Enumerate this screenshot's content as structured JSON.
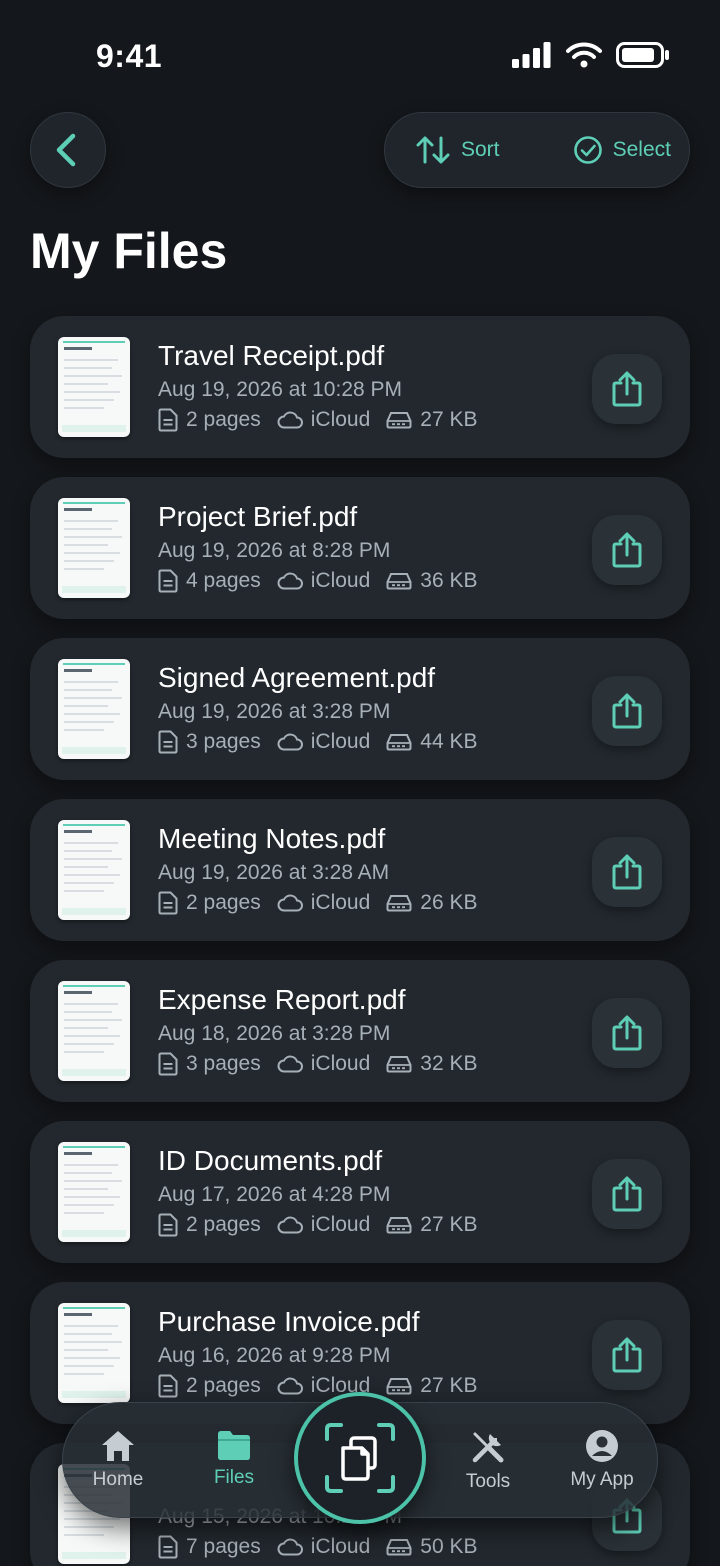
{
  "status_bar": {
    "time": "9:41"
  },
  "toolbar": {
    "sort_label": "Sort",
    "select_label": "Select"
  },
  "title": "My Files",
  "files": [
    {
      "name": "Travel Receipt.pdf",
      "date": "Aug 19, 2026 at 10:28 PM",
      "pages": "2 pages",
      "storage": "iCloud",
      "size": "27 KB",
      "thumb_title": "Travel Receipt"
    },
    {
      "name": "Project Brief.pdf",
      "date": "Aug 19, 2026 at 8:28 PM",
      "pages": "4 pages",
      "storage": "iCloud",
      "size": "36 KB",
      "thumb_title": "Project Brief"
    },
    {
      "name": "Signed Agreement.pdf",
      "date": "Aug 19, 2026 at 3:28 PM",
      "pages": "3 pages",
      "storage": "iCloud",
      "size": "44 KB",
      "thumb_title": "SIGNED AGREEMENT"
    },
    {
      "name": "Meeting Notes.pdf",
      "date": "Aug 19, 2026 at 3:28 AM",
      "pages": "2 pages",
      "storage": "iCloud",
      "size": "26 KB",
      "thumb_title": "Meeting Notes"
    },
    {
      "name": "Expense Report.pdf",
      "date": "Aug 18, 2026 at 3:28 PM",
      "pages": "3 pages",
      "storage": "iCloud",
      "size": "32 KB",
      "thumb_title": "Expense Report"
    },
    {
      "name": "ID Documents.pdf",
      "date": "Aug 17, 2026 at 4:28 PM",
      "pages": "2 pages",
      "storage": "iCloud",
      "size": "27 KB",
      "thumb_title": "ID Documents"
    },
    {
      "name": "Purchase Invoice.pdf",
      "date": "Aug 16, 2026 at 9:28 PM",
      "pages": "2 pages",
      "storage": "iCloud",
      "size": "27 KB",
      "thumb_title": "Purchase Invoice"
    },
    {
      "name": "",
      "date": "Aug 15, 2026 at 10:28 PM",
      "pages": "7 pages",
      "storage": "iCloud",
      "size": "50 KB",
      "thumb_title": ""
    }
  ],
  "nav": {
    "home": "Home",
    "files": "Files",
    "tools": "Tools",
    "my_app": "My App",
    "active": "files"
  },
  "colors": {
    "accent": "#5ecfb6",
    "background": "#14171b",
    "card": "#22282e"
  }
}
